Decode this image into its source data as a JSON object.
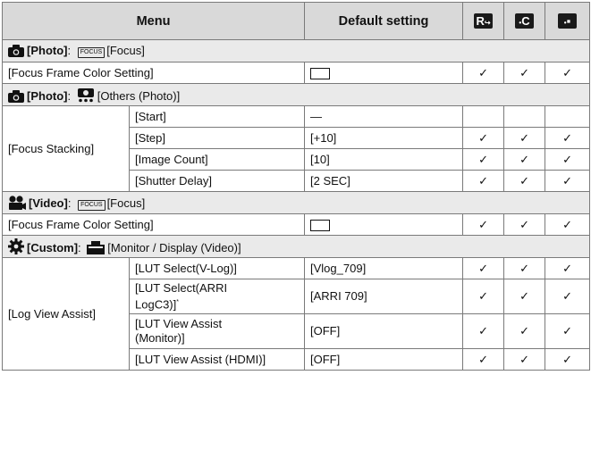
{
  "header": {
    "menu": "Menu",
    "default_setting": "Default setting",
    "icon1": "R",
    "icon2": "C",
    "icon3": "▪"
  },
  "check": "✓",
  "sections": {
    "photo_focus": {
      "cat": "[Photo]",
      "sep": ": ",
      "focus_tag": "FOCUS",
      "sub": "[Focus]"
    },
    "photo_others": {
      "cat": "[Photo]",
      "sep": ": ",
      "sub": "[Others (Photo)]"
    },
    "video_focus": {
      "cat": "[Video]",
      "sep": ": ",
      "focus_tag": "FOCUS",
      "sub": "[Focus]"
    },
    "custom_monitor": {
      "cat": "[Custom]",
      "sep": ": ",
      "sub": "[Monitor / Display (Video)]"
    }
  },
  "rows": {
    "focus_frame_photo": "[Focus Frame Color Setting]",
    "focus_stacking": "[Focus Stacking]",
    "start": "[Start]",
    "start_value": "—",
    "step": "[Step]",
    "step_value": "[+10]",
    "image_count": "[Image Count]",
    "image_count_value": "[10]",
    "shutter_delay": "[Shutter Delay]",
    "shutter_delay_value": "[2 SEC]",
    "focus_frame_video": "[Focus Frame Color Setting]",
    "log_view_assist": "[Log View Assist]",
    "lut_vlog": "[LUT Select(V-Log)]",
    "lut_vlog_value": "[Vlog_709]",
    "lut_arri_a": "[LUT Select(ARRI",
    "lut_arri_b": "LogC3)]",
    "lut_arri_sup": "*",
    "lut_arri_value": "[ARRI 709]",
    "lut_mon_a": "[LUT View Assist",
    "lut_mon_b": "(Monitor)]",
    "lut_mon_value": "[OFF]",
    "lut_hdmi": "[LUT View Assist (HDMI)]",
    "lut_hdmi_value": "[OFF]"
  }
}
